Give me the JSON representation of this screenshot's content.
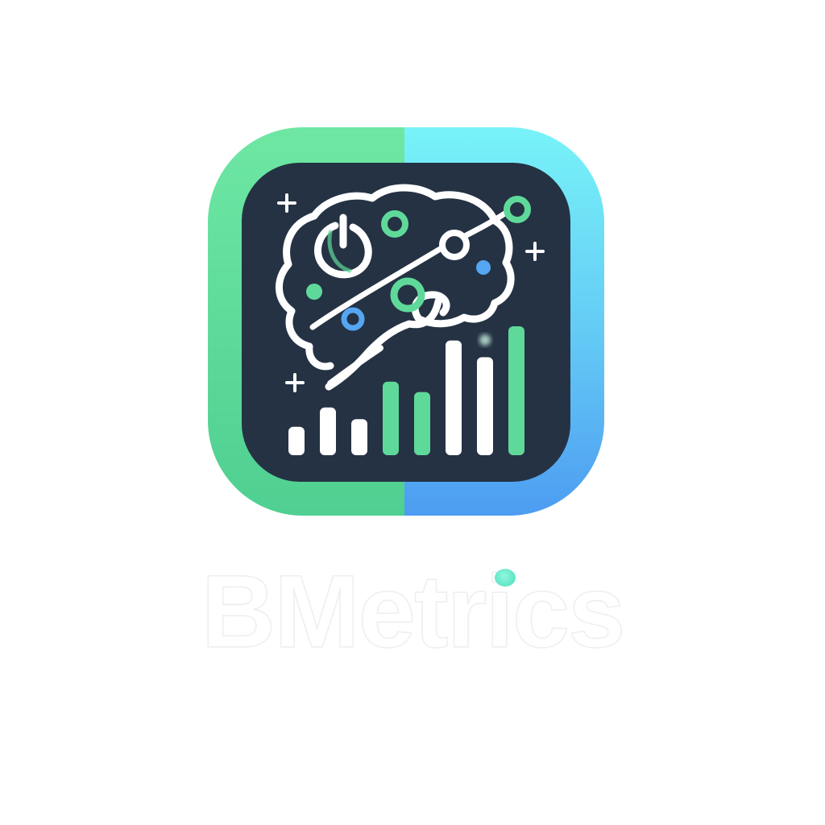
{
  "brand": {
    "name": "BMetrics",
    "colors": {
      "green": "#5fd99a",
      "cyan": "#72eef7",
      "blue": "#55a6f2",
      "panel": "#253244",
      "glyph": "#ffffff",
      "accent_dot": "#6fecd0"
    }
  },
  "icon": {
    "semantic": "brain-analytics-icon",
    "bar_levels": [
      0.22,
      0.37,
      0.28,
      0.57,
      0.49,
      0.89,
      0.76,
      1.0
    ]
  }
}
